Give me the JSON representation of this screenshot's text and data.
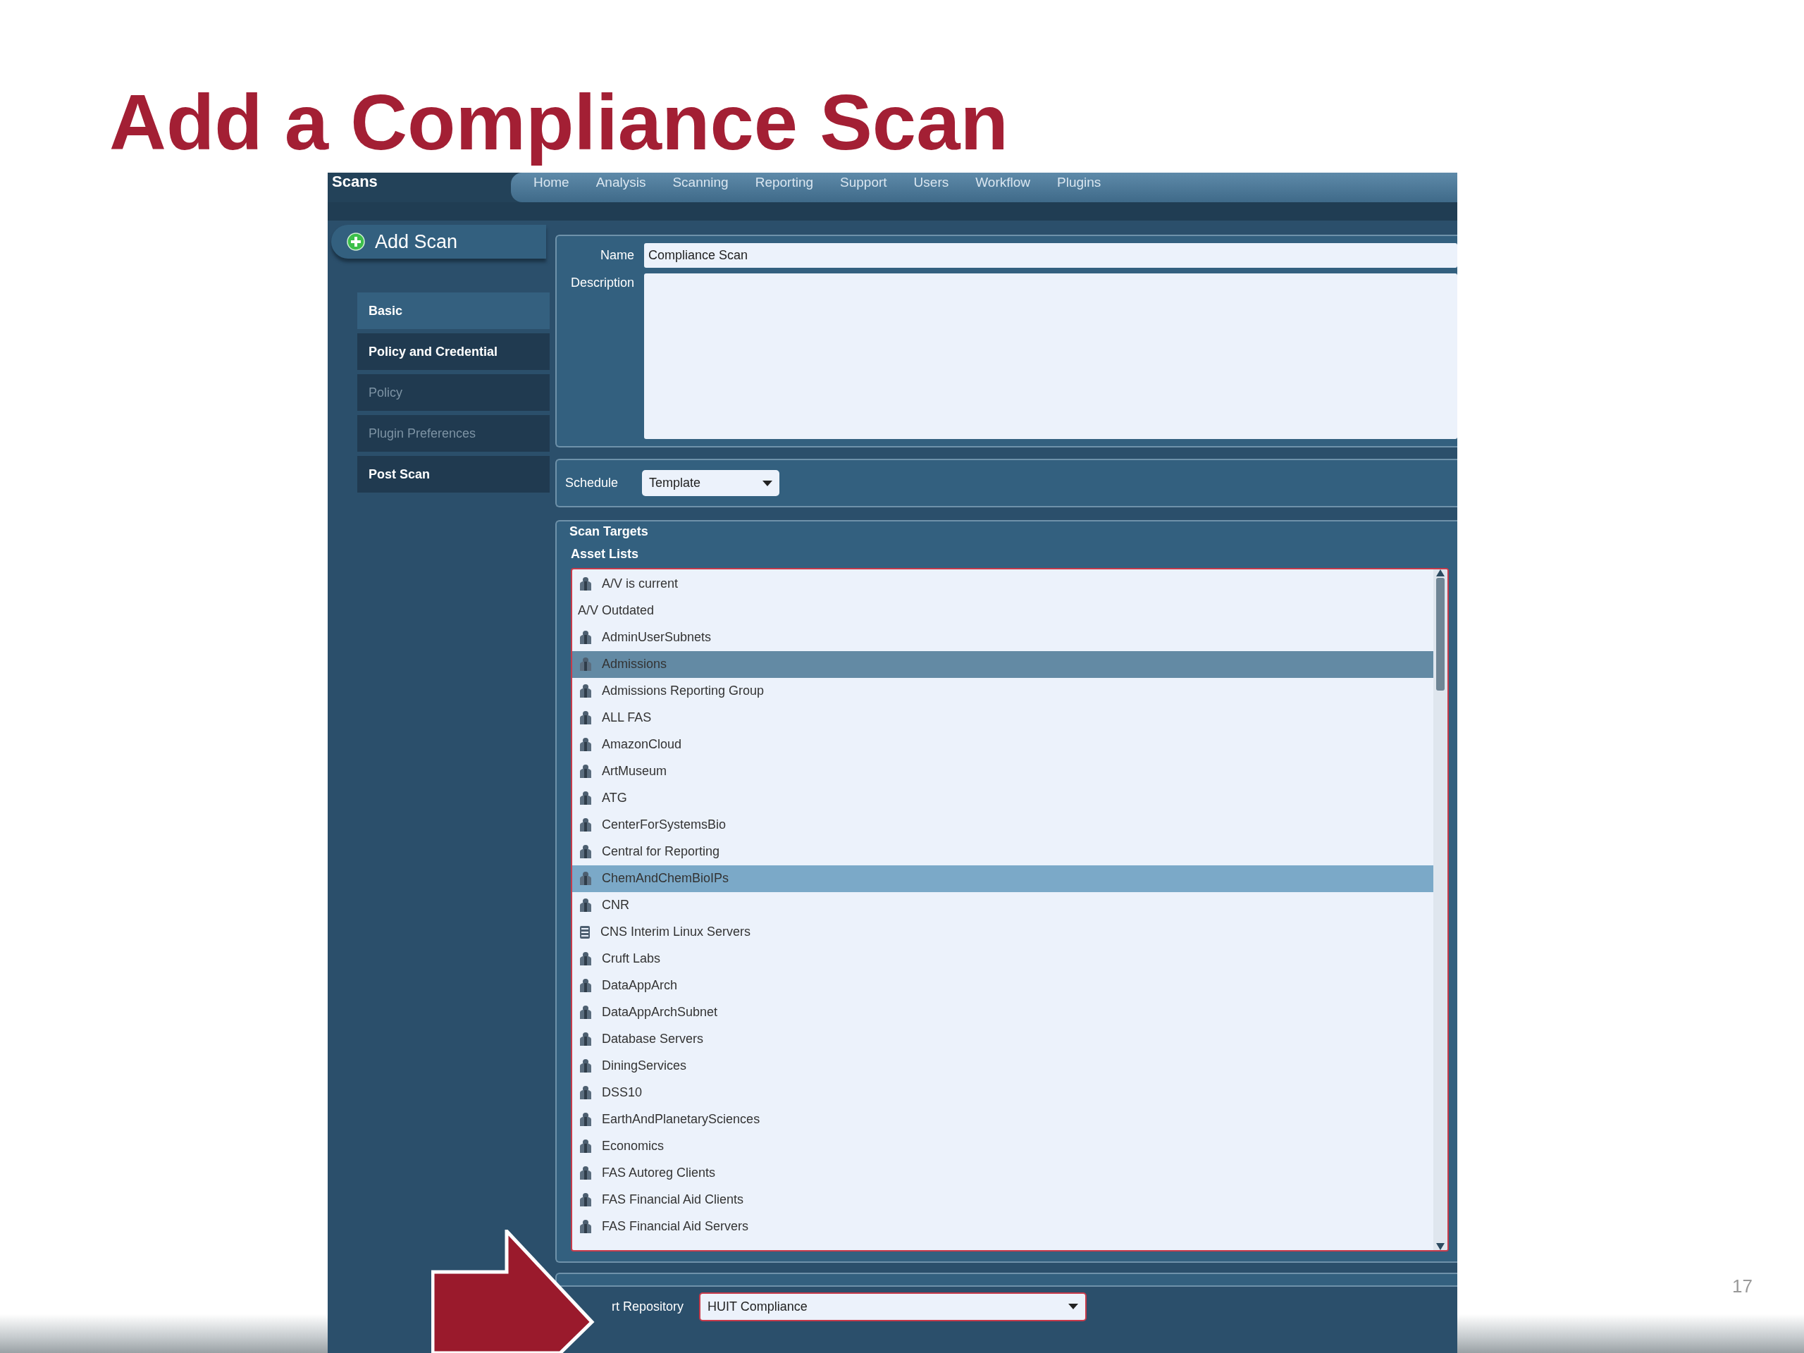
{
  "slide": {
    "title": "Add a Compliance Scan",
    "page_number": "17"
  },
  "app": {
    "section": "Scans",
    "nav": [
      {
        "label": "Home"
      },
      {
        "label": "Analysis"
      },
      {
        "label": "Scanning"
      },
      {
        "label": "Reporting"
      },
      {
        "label": "Support"
      },
      {
        "label": "Users"
      },
      {
        "label": "Workflow"
      },
      {
        "label": "Plugins"
      }
    ],
    "add_button": "Add Scan",
    "steps": [
      {
        "label": "Basic",
        "selected": true,
        "disabled": false
      },
      {
        "label": "Policy and Credential",
        "selected": false,
        "disabled": false
      },
      {
        "label": "Policy",
        "selected": false,
        "disabled": true
      },
      {
        "label": "Plugin Preferences",
        "selected": false,
        "disabled": true
      },
      {
        "label": "Post Scan",
        "selected": false,
        "disabled": false
      }
    ],
    "form": {
      "name_label": "Name",
      "name_value": "Compliance Scan",
      "description_label": "Description",
      "schedule_label": "Schedule",
      "schedule_value": "Template",
      "targets_legend": "Scan Targets",
      "asset_lists_label": "Asset Lists",
      "assets": [
        {
          "label": "A/V is current",
          "kind": "group",
          "selected": false,
          "hovered": false
        },
        {
          "label": "A/V Outdated",
          "kind": "plain",
          "selected": false,
          "hovered": false
        },
        {
          "label": "AdminUserSubnets",
          "kind": "group",
          "selected": false,
          "hovered": false
        },
        {
          "label": "Admissions",
          "kind": "group",
          "selected": true,
          "hovered": false
        },
        {
          "label": "Admissions Reporting Group",
          "kind": "group",
          "selected": false,
          "hovered": false
        },
        {
          "label": "ALL FAS",
          "kind": "group",
          "selected": false,
          "hovered": false
        },
        {
          "label": "AmazonCloud",
          "kind": "group",
          "selected": false,
          "hovered": false
        },
        {
          "label": "ArtMuseum",
          "kind": "group",
          "selected": false,
          "hovered": false
        },
        {
          "label": "ATG",
          "kind": "group",
          "selected": false,
          "hovered": false
        },
        {
          "label": "CenterForSystemsBio",
          "kind": "group",
          "selected": false,
          "hovered": false
        },
        {
          "label": "Central for Reporting",
          "kind": "group",
          "selected": false,
          "hovered": false
        },
        {
          "label": "ChemAndChemBioIPs",
          "kind": "group",
          "selected": false,
          "hovered": true
        },
        {
          "label": "CNR",
          "kind": "group",
          "selected": false,
          "hovered": false
        },
        {
          "label": "CNS Interim Linux Servers",
          "kind": "server",
          "selected": false,
          "hovered": false
        },
        {
          "label": "Cruft Labs",
          "kind": "group",
          "selected": false,
          "hovered": false
        },
        {
          "label": "DataAppArch",
          "kind": "group",
          "selected": false,
          "hovered": false
        },
        {
          "label": "DataAppArchSubnet",
          "kind": "group",
          "selected": false,
          "hovered": false
        },
        {
          "label": "Database Servers",
          "kind": "group",
          "selected": false,
          "hovered": false
        },
        {
          "label": "DiningServices",
          "kind": "group",
          "selected": false,
          "hovered": false
        },
        {
          "label": "DSS10",
          "kind": "group",
          "selected": false,
          "hovered": false
        },
        {
          "label": "EarthAndPlanetarySciences",
          "kind": "group",
          "selected": false,
          "hovered": false
        },
        {
          "label": "Economics",
          "kind": "group",
          "selected": false,
          "hovered": false
        },
        {
          "label": "FAS Autoreg Clients",
          "kind": "group",
          "selected": false,
          "hovered": false
        },
        {
          "label": "FAS Financial Aid Clients",
          "kind": "group",
          "selected": false,
          "hovered": false
        },
        {
          "label": "FAS Financial Aid Servers",
          "kind": "group",
          "selected": false,
          "hovered": false
        }
      ],
      "repository_label": "rt Repository",
      "repository_value": "HUIT Compliance"
    }
  }
}
